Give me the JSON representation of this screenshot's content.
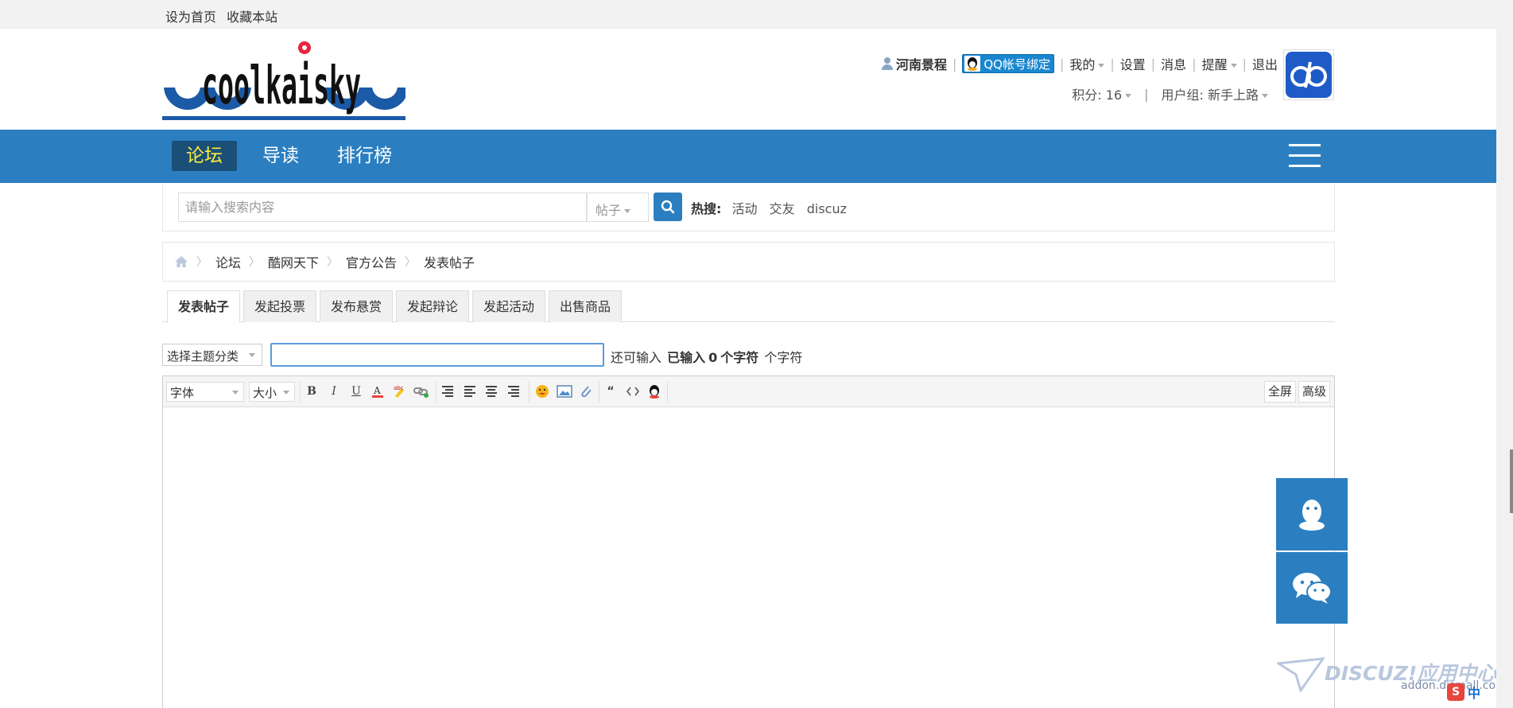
{
  "topbar": {
    "set_home": "设为首页",
    "bookmark": "收藏本站"
  },
  "logo": {
    "text": "coolkaisky"
  },
  "user": {
    "name": "河南景程",
    "qq_bind": "QQ帐号绑定",
    "menu_my": "我的",
    "menu_settings": "设置",
    "menu_messages": "消息",
    "menu_remind": "提醒",
    "menu_logout": "退出",
    "points": "积分: 16",
    "group": "用户组: 新手上路"
  },
  "nav": {
    "items": [
      "论坛",
      "导读",
      "排行榜"
    ]
  },
  "search": {
    "placeholder": "请输入搜索内容",
    "type": "帖子",
    "hot_label": "热搜:",
    "hot_keywords": [
      "活动",
      "交友",
      "discuz"
    ]
  },
  "breadcrumb": [
    "论坛",
    "酷网天下",
    "官方公告",
    "发表帖子"
  ],
  "tabs": [
    "发表帖子",
    "发起投票",
    "发布悬赏",
    "发起辩论",
    "发起活动",
    "出售商品"
  ],
  "compose": {
    "type_select": "选择主题分类",
    "subject_value": "",
    "counter_prefix": "还可输入",
    "counter_entered": "已输入",
    "counter_value": "0",
    "counter_unit": "个字符",
    "counter_suffix": "个字符"
  },
  "editor": {
    "font_select": "字体",
    "size_select": "大小",
    "fullscreen": "全屏",
    "advanced": "高级",
    "tools": [
      "bold-icon",
      "italic-icon",
      "underline-icon",
      "font-color-icon",
      "background-color-icon",
      "link-icon",
      "align-left-icon",
      "align-justify-icon",
      "align-center-icon",
      "align-right-icon",
      "smiley-icon",
      "image-icon",
      "attachment-icon",
      "quote-icon",
      "code-icon",
      "qq-icon"
    ]
  },
  "watermark": {
    "brand": "DISCUZ!应用中心",
    "url": "addon.dismall.com"
  },
  "colors": {
    "nav_bg": "#2b7fc1",
    "nav_active_bg": "#1a4f78",
    "nav_active_text": "#ffeb3b",
    "float_bg": "#2b7fc1"
  }
}
